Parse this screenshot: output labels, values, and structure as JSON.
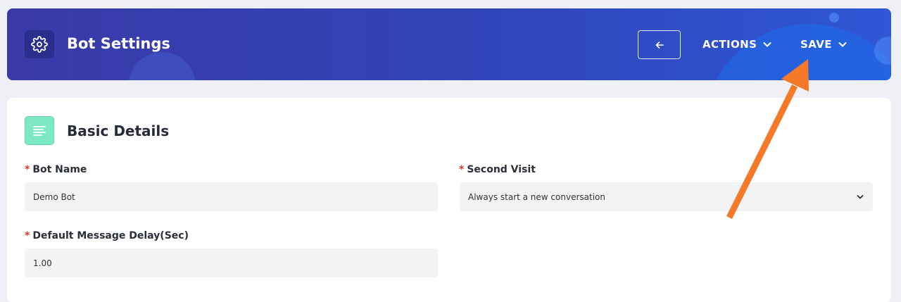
{
  "header": {
    "title": "Bot Settings",
    "back_label": "←",
    "actions_label": "ACTIONS",
    "save_label": "SAVE"
  },
  "section": {
    "title": "Basic Details"
  },
  "fields": {
    "bot_name": {
      "required_mark": "*",
      "label": "Bot Name",
      "value": "Demo Bot"
    },
    "second_visit": {
      "required_mark": "*",
      "label": "Second Visit",
      "value": "Always start a new conversation"
    },
    "message_delay": {
      "required_mark": "*",
      "label": "Default Message Delay(Sec)",
      "value": "1.00"
    }
  },
  "colors": {
    "header_start": "#3a3aa8",
    "header_end": "#2f57d6",
    "section_icon": "#7de8c4",
    "required": "#e0352b",
    "annotation_arrow": "#f47a2a"
  },
  "icons": {
    "header": "gear-icon",
    "section": "text-lines-icon",
    "back": "arrow-left-icon",
    "dropdown": "chevron-down-icon"
  }
}
